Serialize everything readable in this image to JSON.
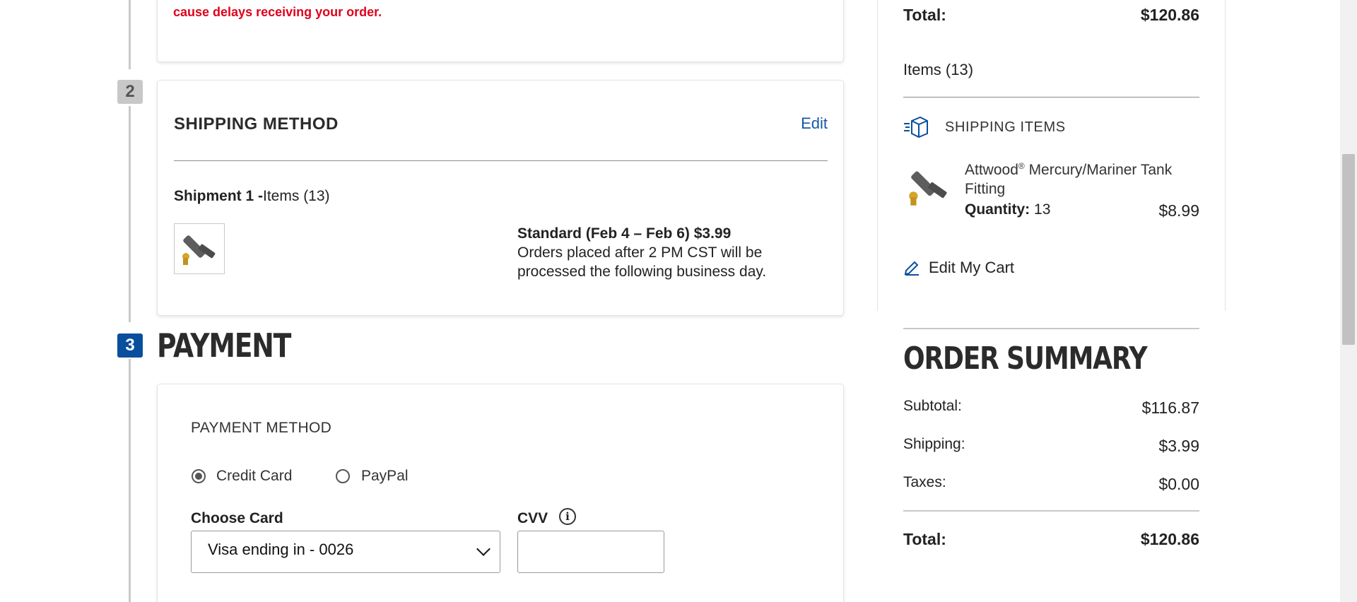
{
  "warning": {
    "text": "cause delays receiving your order."
  },
  "steps": {
    "shipping_number": "2",
    "payment_number": "3"
  },
  "shipping_method": {
    "title": "SHIPPING METHOD",
    "edit_label": "Edit",
    "shipment_label": "Shipment 1 -",
    "shipment_items": "Items (13)",
    "option_title": "Standard (Feb 4 – Feb 6) $3.99",
    "option_desc": "Orders placed after 2 PM CST will be processed the following business day."
  },
  "payment": {
    "heading": "PAYMENT",
    "method_title": "PAYMENT METHOD",
    "options": [
      {
        "label": "Credit Card",
        "selected": true
      },
      {
        "label": "PayPal",
        "selected": false
      }
    ],
    "choose_card_label": "Choose Card",
    "choose_card_value": "Visa ending in - 0026",
    "cvv_label": "CVV",
    "cvv_value": ""
  },
  "cart": {
    "top_total_label": "Total:",
    "top_total_value": "$120.86",
    "items_count": "Items (13)",
    "shipping_items_title": "SHIPPING ITEMS",
    "item": {
      "name_brand": "Attwood",
      "reg_mark": "®",
      "name_rest": " Mercury/Mariner Tank Fitting",
      "quantity_label": "Quantity:",
      "quantity_value": "13",
      "price": "$8.99"
    },
    "edit_cart_label": "Edit My Cart"
  },
  "order_summary": {
    "title": "ORDER SUMMARY",
    "rows": [
      {
        "label": "Subtotal:",
        "value": "$116.87"
      },
      {
        "label": "Shipping:",
        "value": "$3.99"
      },
      {
        "label": "Taxes:",
        "value": "$0.00"
      }
    ],
    "total_label": "Total:",
    "total_value": "$120.86"
  },
  "colors": {
    "accent_blue": "#0a4f9e",
    "link_blue": "#1558a7",
    "warning_red": "#e0001b"
  },
  "icons": [
    "box-icon",
    "pencil-icon",
    "info-icon",
    "chevron-down-icon"
  ]
}
